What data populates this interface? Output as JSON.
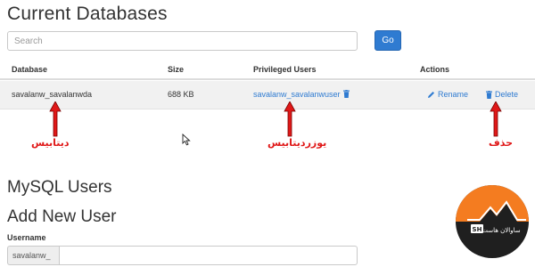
{
  "page": {
    "title": "Current Databases"
  },
  "search": {
    "placeholder": "Search",
    "value": "",
    "go_label": "Go"
  },
  "table": {
    "headers": [
      "Database",
      "Size",
      "Privileged Users",
      "Actions"
    ],
    "rows": [
      {
        "database": "savalanw_savalanwda",
        "size": "688 KB",
        "user": "savalanw_savalanwuser",
        "rename_label": "Rename",
        "delete_label": "Delete"
      }
    ]
  },
  "annotations": {
    "database": "دیتابیس",
    "user": "یوزردیتابیس",
    "delete": "حذف",
    "color": "#e01818"
  },
  "sections": {
    "mysql_users": "MySQL Users",
    "add_new_user": "Add New User"
  },
  "new_user": {
    "username_label": "Username",
    "prefix": "savalanw_",
    "value": ""
  },
  "watermark": {
    "text": "ساوالان هاست",
    "badge": "SH"
  },
  "colors": {
    "accent": "#2f7bd1",
    "row_bg": "#f1f1f1",
    "logo_orange": "#f47c20",
    "logo_dark": "#1f1f1f"
  },
  "icons": {
    "trash": "trash-icon",
    "rename": "pencil-icon",
    "cursor": "mouse-pointer-icon"
  }
}
